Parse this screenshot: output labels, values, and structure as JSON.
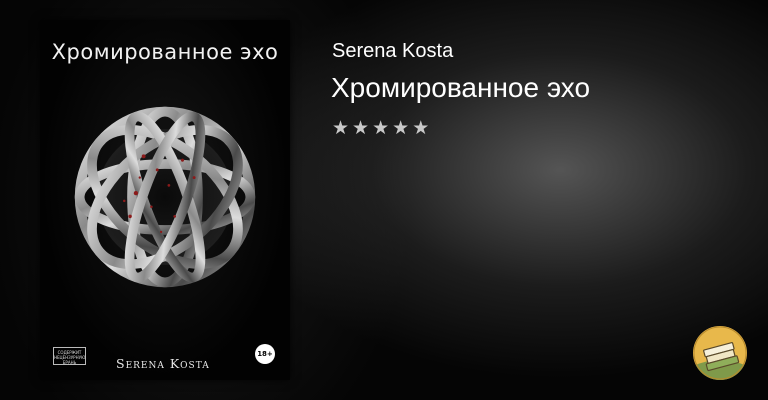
{
  "cover": {
    "title": "Хромированное эхо",
    "author": "Serena Kosta",
    "age_rating": "18+",
    "content_badge": "СОДЕРЖИТ\nНЕЦЕНЗУРНУЮ\nБРАНЬ"
  },
  "book": {
    "author": "Serena Kosta",
    "title": "Хромированное эхо",
    "rating": {
      "max": 5,
      "value": 0,
      "star_glyph": "★"
    }
  },
  "logo": {
    "icon": "book-stack-icon"
  },
  "colors": {
    "star": "#c9c9c9",
    "logo_bg": "#e8b84b",
    "logo_ring": "#7f9a4a"
  }
}
